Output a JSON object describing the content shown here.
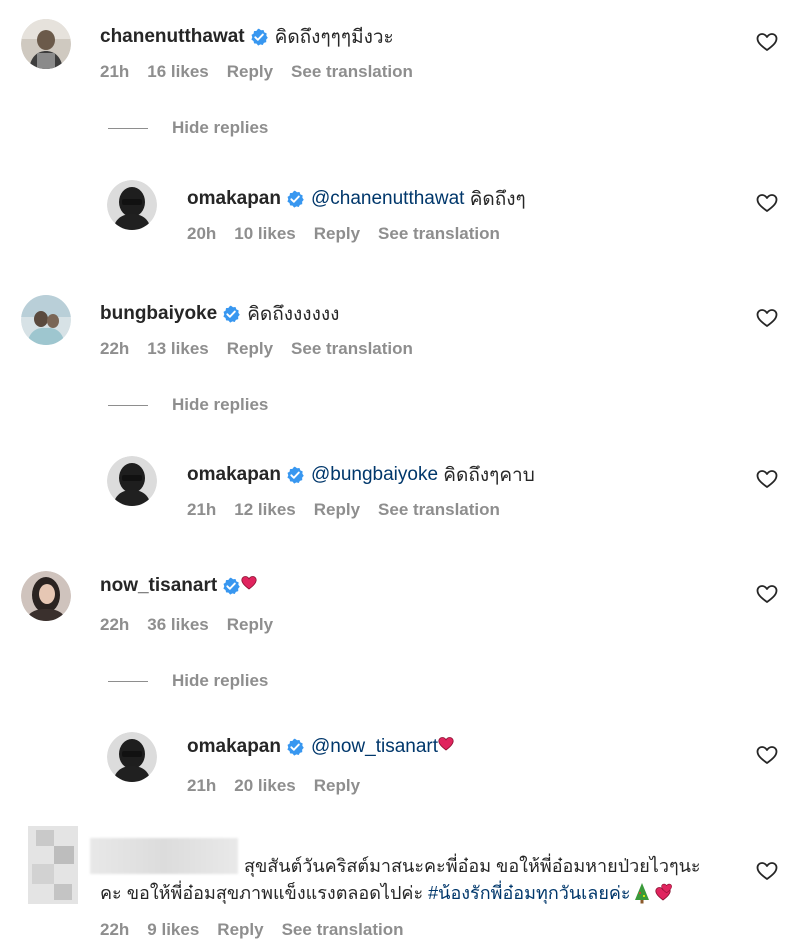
{
  "comments": [
    {
      "username": "chanenutthawat",
      "text": "คิดถึงๆๆๆมีงวะ",
      "time": "21h",
      "likes": "16 likes",
      "reply": "Reply",
      "translate": "See translation",
      "hide_replies": "Hide replies",
      "reply_item": {
        "username": "omakapan",
        "mention": "@chanenutthawat",
        "text": " คิดถึงๆ",
        "time": "20h",
        "likes": "10 likes",
        "reply": "Reply",
        "translate": "See translation"
      }
    },
    {
      "username": "bungbaiyoke",
      "text": "คิดถึงงงงงง",
      "time": "22h",
      "likes": "13 likes",
      "reply": "Reply",
      "translate": "See translation",
      "hide_replies": "Hide replies",
      "reply_item": {
        "username": "omakapan",
        "mention": "@bungbaiyoke",
        "text": " คิดถึงๆคาบ",
        "time": "21h",
        "likes": "12 likes",
        "reply": "Reply",
        "translate": "See translation"
      }
    },
    {
      "username": "now_tisanart",
      "text": "",
      "time": "22h",
      "likes": "36 likes",
      "reply": "Reply",
      "hide_replies": "Hide replies",
      "reply_item": {
        "username": "omakapan",
        "mention": "@now_tisanart",
        "text": "",
        "time": "21h",
        "likes": "20 likes",
        "reply": "Reply"
      }
    }
  ],
  "last_comment": {
    "text_line1": "สุขสันต์วันคริสต์มาสนะคะพี่อ๋อม ขอให้พี่อ๋อมหายป่วยไวๆนะ",
    "text_line2_plain": "คะ ขอให้พี่อ๋อมสุขภาพแข็งแรงตลอดไปค่ะ ",
    "hashtag": "#น้องรักพี่อ๋อมทุกวันเลยค่ะ",
    "time": "22h",
    "likes": "9 likes",
    "reply": "Reply",
    "translate": "See translation"
  },
  "icons": {
    "verified": "verified-badge-icon",
    "like": "heart-outline-icon",
    "heart_emoji": "red-heart-emoji",
    "tree_emoji": "christmas-tree-emoji"
  },
  "colors": {
    "verified": "#3897f0",
    "link": "#00376b",
    "meta": "#8e8e8e",
    "heart": "#e0245e"
  }
}
